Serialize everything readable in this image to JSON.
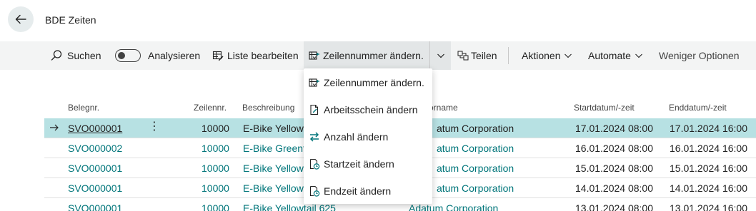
{
  "header": {
    "title": "BDE Zeiten",
    "back_icon": "arrow-left-icon"
  },
  "toolbar": {
    "search_label": "Suchen",
    "analyze_label": "Analysieren",
    "analyze_on": false,
    "edit_list_label": "Liste bearbeiten",
    "change_line_label": "Zeilennummer ändern.",
    "share_label": "Teilen",
    "actions_label": "Aktionen",
    "automate_label": "Automate",
    "fewer_options_label": "Weniger Optionen"
  },
  "dropdown": {
    "items": [
      {
        "label": "Zeilennummer ändern.",
        "icon": "renumber-icon"
      },
      {
        "label": "Arbeitsschein ändern",
        "icon": "document-edit-icon"
      },
      {
        "label": "Anzahl ändern",
        "icon": "swap-arrows-icon"
      },
      {
        "label": "Startzeit ändern",
        "icon": "clock-document-icon"
      },
      {
        "label": "Endzeit ändern",
        "icon": "clock-document-icon"
      }
    ]
  },
  "table": {
    "columns": {
      "doc_no": "Belegnr.",
      "line_no": "Zeilennr.",
      "description": "Beschreibung",
      "name_hidden": "orname",
      "start": "Startdatum/-zeit",
      "end": "Enddatum/-zeit"
    },
    "rows": [
      {
        "doc_no": "SVO000001",
        "line_no": "10000",
        "description": "E-Bike Yellowt",
        "customer": "atum Corporation",
        "start": "17.01.2024 08:00",
        "end": "17.01.2024 16:00",
        "selected": true
      },
      {
        "doc_no": "SVO000002",
        "line_no": "10000",
        "description": "E-Bike Greent",
        "customer": "atum Corporation",
        "start": "16.01.2024 08:00",
        "end": "16.01.2024 16:00",
        "selected": false
      },
      {
        "doc_no": "SVO000001",
        "line_no": "10000",
        "description": "E-Bike Yellowt",
        "customer": "atum Corporation",
        "start": "15.01.2024 08:00",
        "end": "15.01.2024 16:00",
        "selected": false
      },
      {
        "doc_no": "SVO000001",
        "line_no": "10000",
        "description": "E-Bike Yellowt",
        "customer": "atum Corporation",
        "start": "14.01.2024 08:00",
        "end": "14.01.2024 16:00",
        "selected": false
      },
      {
        "doc_no": "SVO000001",
        "line_no": "10000",
        "description": "E-Bike Yellowtail 625",
        "customer": "Adatum Corporation",
        "start": "13.01.2024 08:00",
        "end": "13.01.2024 16:00",
        "selected": false
      }
    ]
  },
  "colors": {
    "accent": "#00757a",
    "selected_row": "#b7e1e3",
    "toolbar_bg": "#f3f4f4"
  }
}
